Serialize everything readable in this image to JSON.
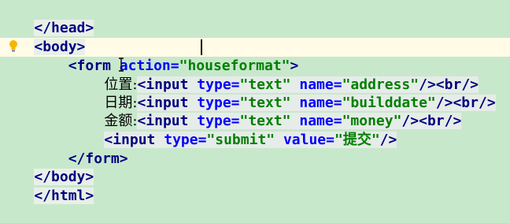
{
  "lines": [
    {
      "code": "</head>"
    },
    {
      "code": "<body>"
    },
    {
      "code": "    <form action=\"houseformat\">"
    },
    {
      "label": "位置:",
      "code": "<input type=\"text\" name=\"address\"/><br/>"
    },
    {
      "label": "日期:",
      "code": "<input type=\"text\" name=\"builddate\"/><br/>"
    },
    {
      "label": "金额:",
      "code": "<input type=\"text\" name=\"money\"/><br/>"
    },
    {
      "code": "<input type=\"submit\" value=\"提交\"/>"
    },
    {
      "code": "    </form>"
    },
    {
      "code": "</body>"
    },
    {
      "code": "</html>"
    }
  ],
  "colors": {
    "background": "#c8e8cc",
    "current_line": "#fffbe6",
    "tag": "#000080",
    "attribute": "#0000ff",
    "value": "#008000"
  },
  "icons": {
    "intention": "lightbulb-icon",
    "caret": "text-caret",
    "mouse": "ibeam-cursor-icon"
  }
}
